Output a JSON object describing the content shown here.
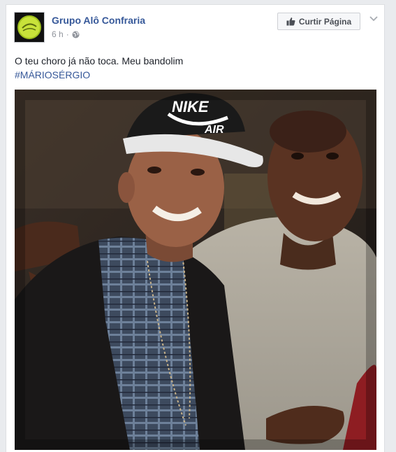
{
  "post": {
    "page_name": "Grupo Alô Confraria",
    "timestamp": "6 h",
    "separator": "·",
    "like_page_label": "Curtir Página",
    "text": "O teu choro já não toca. Meu bandolim",
    "hashtag": "#MÁRIOSÉRGIO"
  },
  "icons": {
    "avatar": "group-logo-avatar",
    "privacy": "globe-icon",
    "like": "thumbs-up-icon",
    "menu": "chevron-down-icon"
  },
  "photo": {
    "cap_text_line1": "NIKE",
    "cap_text_line2": "AIR"
  },
  "colors": {
    "link": "#365899",
    "meta": "#90949c",
    "text": "#1d2129",
    "button_bg": "#f6f7f9",
    "button_border": "#ced0d4",
    "avatar_green": "#c8e23a"
  }
}
